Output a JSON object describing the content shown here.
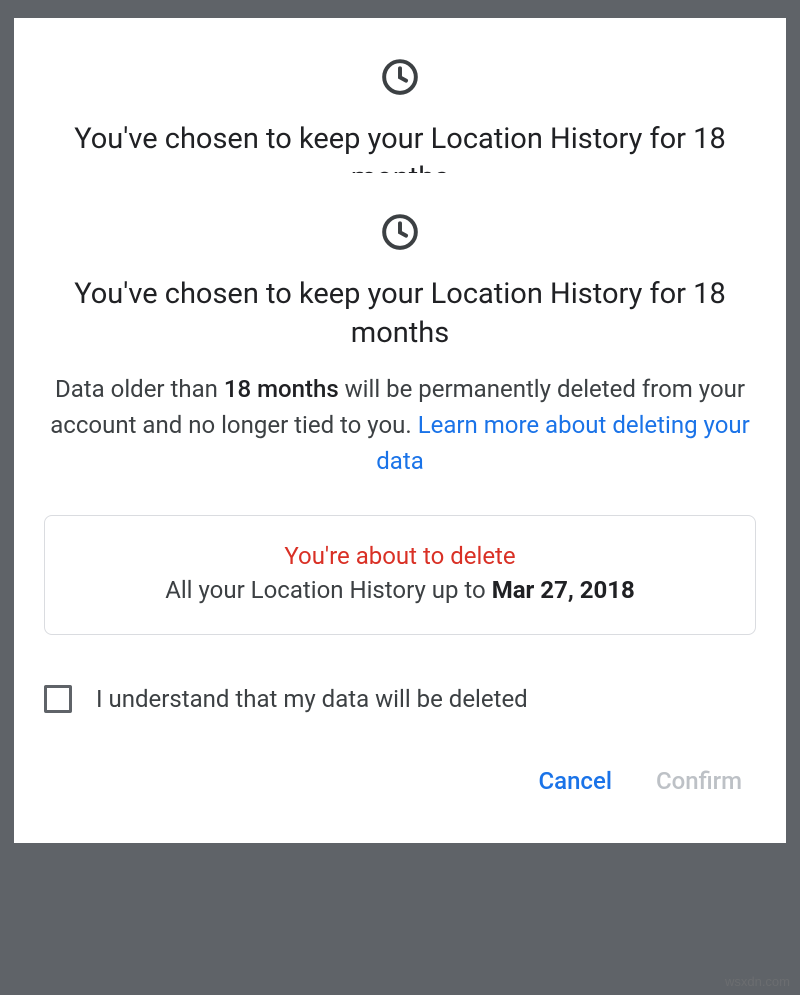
{
  "headline": "You've chosen to keep your Location History for 18 months",
  "body": {
    "pre": "Data older than ",
    "bold": "18 months",
    "post": " will be permanently deleted from your account and no longer tied to you. "
  },
  "learn_more": "Learn more about deleting your data",
  "warning": {
    "title": "You're about to delete",
    "pre": "All your Location History up to ",
    "date": "Mar 27, 2018"
  },
  "consent_label": "I understand that my data will be deleted",
  "actions": {
    "cancel": "Cancel",
    "confirm": "Confirm"
  },
  "watermark": "wsxdn.com"
}
